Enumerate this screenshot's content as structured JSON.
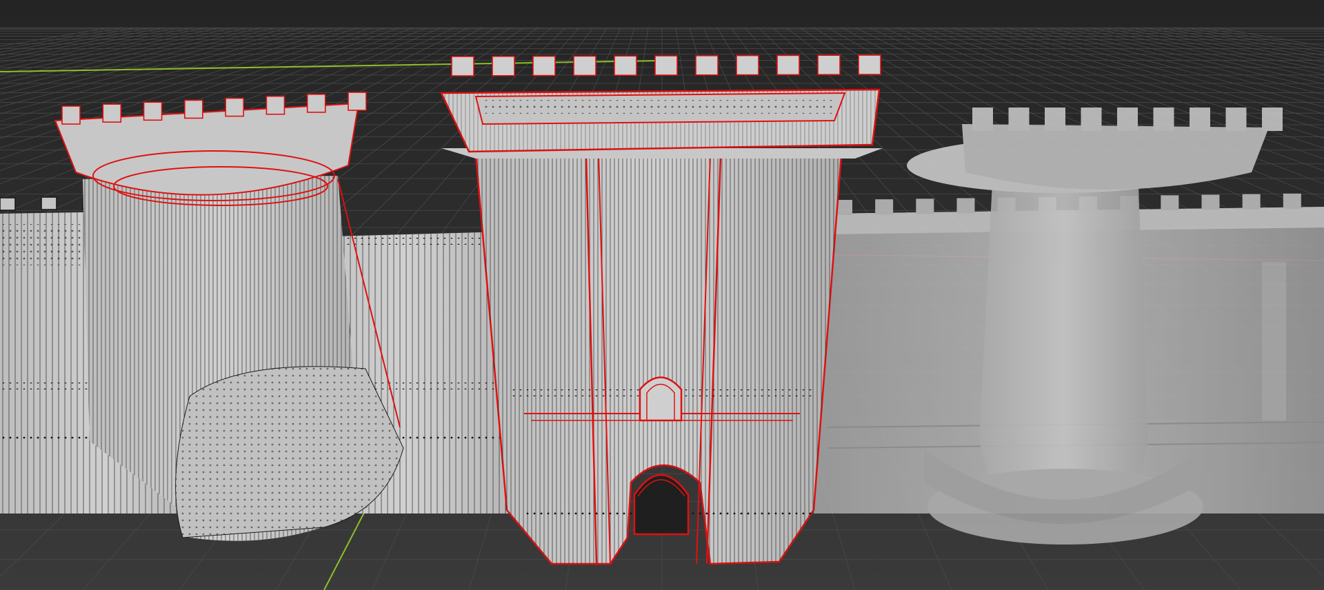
{
  "app": {
    "view": "3d-viewport",
    "mode": "edit-mode-wireframe"
  },
  "colors": {
    "background_top": "#2a2a2a",
    "background_bottom": "#3a3a3a",
    "grid_line": "#4a4a4a",
    "grid_line_major": "#555555",
    "x_axis": "#b0303a",
    "y_axis": "#8fbf2a",
    "mesh_fill": "#c4c4c4",
    "mesh_fill_ghost": "#b8b8b8",
    "wire": "#1a1a1a",
    "selected_edge": "#e01010",
    "vertex": "#111111"
  },
  "objects": [
    {
      "name": "left-tower-wireframe",
      "state": "edit"
    },
    {
      "name": "gatehouse-selected",
      "state": "selected"
    },
    {
      "name": "curtain-walls-wireframe",
      "state": "edit"
    },
    {
      "name": "right-tower-solid",
      "state": "ghost"
    },
    {
      "name": "right-wall-solid",
      "state": "ghost"
    }
  ],
  "icons": {
    "arch": "arch-icon",
    "crenellation": "crenellation-icon"
  }
}
